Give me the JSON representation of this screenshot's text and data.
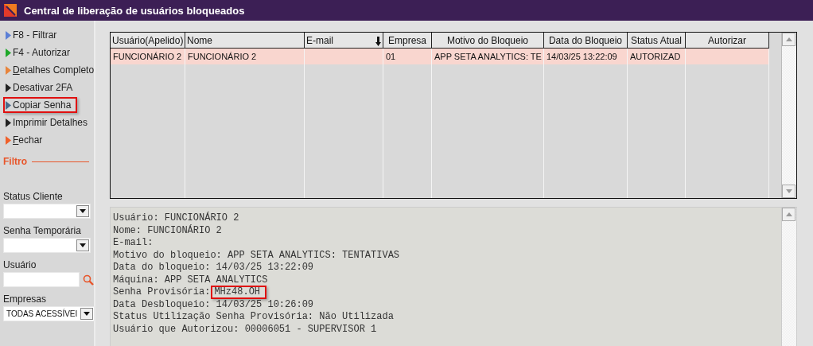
{
  "window": {
    "title": "Central de liberação de usuários bloqueados"
  },
  "sidebar": {
    "actions": [
      {
        "label": "F8 - Filtrar",
        "color": "#5b7fd6",
        "underline_first": false,
        "highlighted": false
      },
      {
        "label": "F4 - Autorizar",
        "color": "#1fa82a",
        "underline_first": false,
        "highlighted": false
      },
      {
        "label": "Detalhes Completo",
        "color": "#e8843c",
        "underline_first": true,
        "highlighted": false
      },
      {
        "label": "Desativar 2FA",
        "color": "#222222",
        "underline_first": false,
        "highlighted": false
      },
      {
        "label": "Copiar Senha",
        "color": "#4a6a8a",
        "underline_first": false,
        "highlighted": true
      },
      {
        "label": "Imprimir Detalhes",
        "color": "#222222",
        "underline_first": false,
        "highlighted": false
      },
      {
        "label": "Fechar",
        "color": "#f0602a",
        "underline_first": true,
        "highlighted": false
      }
    ],
    "filter_title": "Filtro",
    "filters": [
      {
        "kind": "select",
        "label": "Status Cliente"
      },
      {
        "kind": "select",
        "label": "Senha Temporária"
      },
      {
        "kind": "search",
        "label": "Usuário"
      },
      {
        "kind": "select",
        "label": "Empresas",
        "value": "TODAS ACESSÍVEI"
      }
    ]
  },
  "table": {
    "columns": [
      {
        "label": "Usuário(Apelido)",
        "sorted": false
      },
      {
        "label": "Nome",
        "sorted": false
      },
      {
        "label": "E-mail",
        "sorted": true
      },
      {
        "label": "Empresa",
        "sorted": false
      },
      {
        "label": "Motivo do Bloqueio",
        "sorted": false
      },
      {
        "label": "Data do Bloqueio",
        "sorted": false
      },
      {
        "label": "Status Atual",
        "sorted": false
      },
      {
        "label": "Autorizar",
        "sorted": false
      }
    ],
    "rows": [
      {
        "selected": true,
        "cells": [
          "FUNCIONÁRIO 2",
          "FUNCIONÁRIO 2",
          "",
          "01",
          "APP SETA ANALYTICS: TE",
          "14/03/25 13:22:09",
          "AUTORIZAD",
          ""
        ]
      }
    ]
  },
  "details": {
    "lines": [
      {
        "text": "Usuário: FUNCIONÁRIO 2"
      },
      {
        "text": "Nome: FUNCIONÁRIO 2"
      },
      {
        "text": "E-mail:"
      },
      {
        "text": "Motivo do bloqueio: APP SETA ANALYTICS: TENTATIVAS"
      },
      {
        "text": "Data do bloqueio: 14/03/25 13:22:09"
      },
      {
        "text": "Máquina: APP SETA ANALYTICS"
      },
      {
        "text": "Senha Provisória:",
        "value": "MHz48.OH",
        "highlighted": true
      },
      {
        "text": "Data Desbloqueio: 14/03/25 10:26:09"
      },
      {
        "text": "Status Utilização Senha Provisória: Não Utilizada"
      },
      {
        "text": "Usuário que Autorizou: 00006051 - SUPERVISOR 1"
      }
    ]
  }
}
